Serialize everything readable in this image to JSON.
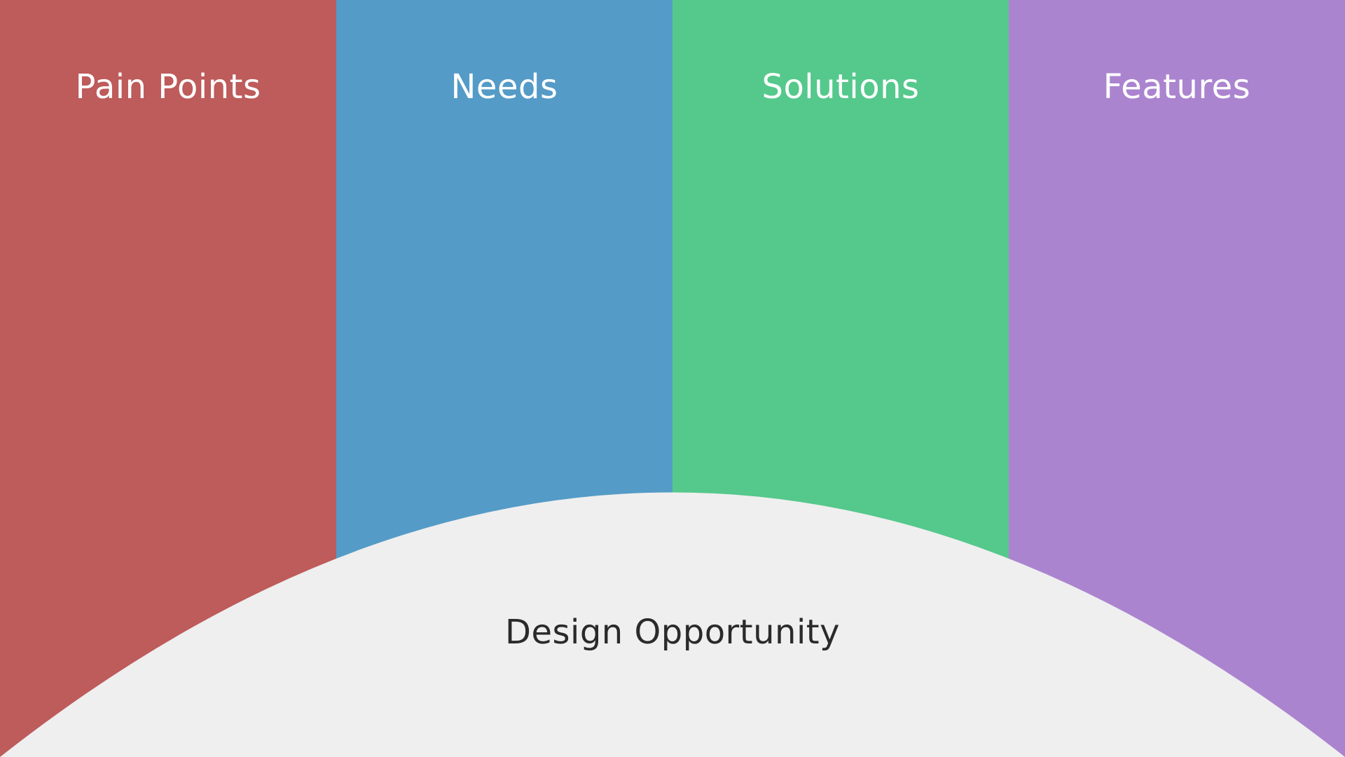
{
  "columns": [
    {
      "label": "Pain Points",
      "color": "#be5b5b"
    },
    {
      "label": "Needs",
      "color": "#549bc7"
    },
    {
      "label": "Solutions",
      "color": "#55c88c"
    },
    {
      "label": "Features",
      "color": "#ab84d0"
    }
  ],
  "opportunity": {
    "label": "Design Opportunity",
    "fill": "#efefef",
    "text_color": "#2a2a2a"
  }
}
